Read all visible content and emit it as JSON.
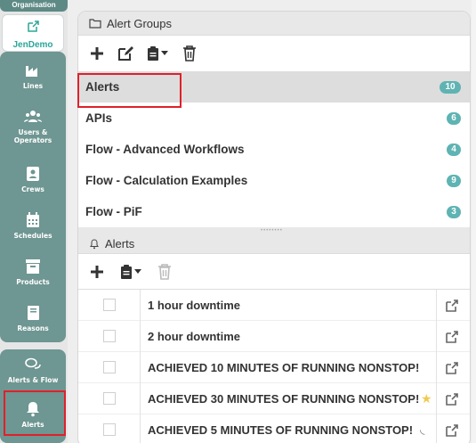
{
  "sidebar": {
    "org_label": "Organisation",
    "jendemo_label": "JenDemo",
    "items": [
      {
        "label": "Lines",
        "icon": "factory-icon"
      },
      {
        "label": "Users &\nOperators",
        "icon": "users-icon"
      },
      {
        "label": "Crews",
        "icon": "crew-icon"
      },
      {
        "label": "Schedules",
        "icon": "calendar-icon"
      },
      {
        "label": "Products",
        "icon": "box-icon"
      },
      {
        "label": "Reasons",
        "icon": "book-icon"
      }
    ],
    "alerts_flow_label": "Alerts & Flow",
    "alerts_label": "Alerts"
  },
  "alert_groups": {
    "title": "Alert Groups",
    "rows": [
      {
        "name": "Alerts",
        "count": "10"
      },
      {
        "name": "APIs",
        "count": "6"
      },
      {
        "name": "Flow - Advanced Workflows",
        "count": "4"
      },
      {
        "name": "Flow - Calculation Examples",
        "count": "9"
      },
      {
        "name": "Flow - PiF",
        "count": "3"
      }
    ]
  },
  "alerts": {
    "title": "Alerts",
    "rows": [
      {
        "name": "1 hour downtime"
      },
      {
        "name": "2 hour downtime"
      },
      {
        "name": "ACHIEVED 10 MINUTES OF RUNNING NONSTOP!"
      },
      {
        "name": "ACHIEVED 30 MINUTES OF RUNNING NONSTOP!"
      },
      {
        "name": "ACHIEVED 5 MINUTES OF RUNNING NONSTOP!"
      }
    ]
  },
  "colors": {
    "sidebar_bg": "#6e9692",
    "accent": "#2aa69a",
    "badge": "#5fb3b3",
    "highlight_border": "#e0202a"
  }
}
